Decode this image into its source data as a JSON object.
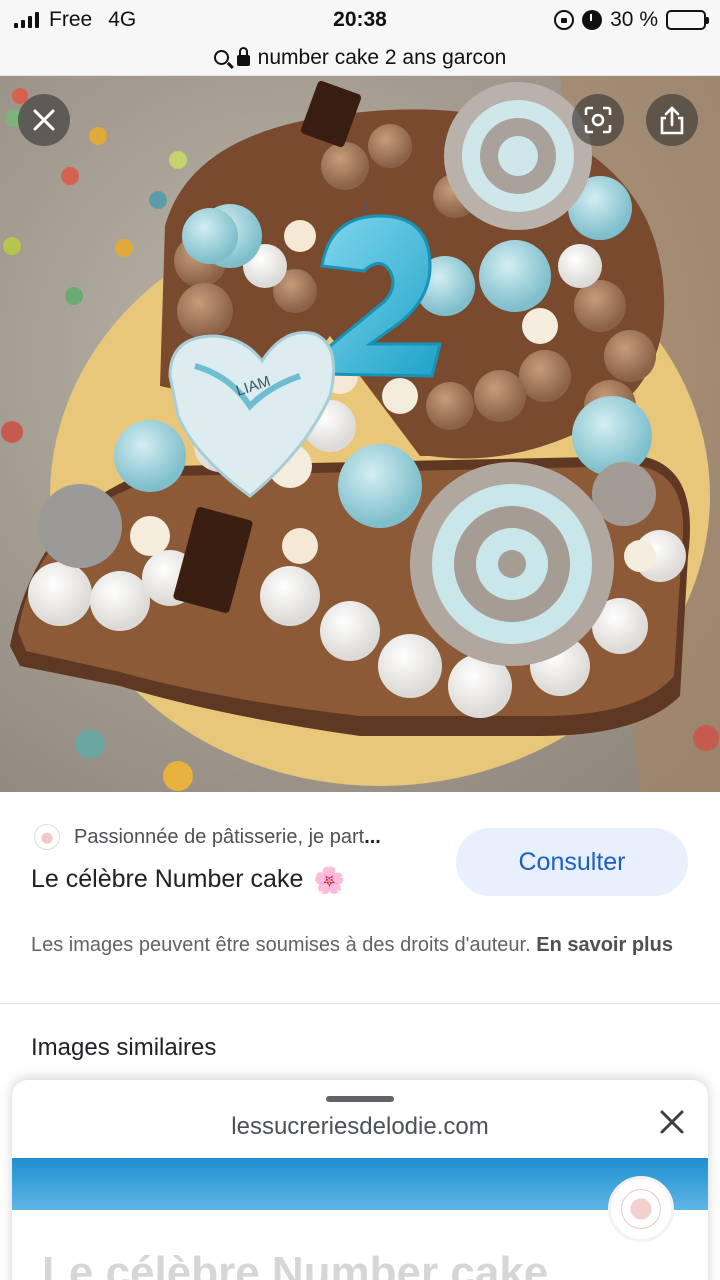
{
  "status_bar": {
    "carrier": "Free",
    "network": "4G",
    "time": "20:38",
    "battery": "30 %",
    "battery_level": 0.3,
    "icons": [
      "signal-icon",
      "rotation-lock-icon",
      "alarm-icon",
      "battery-icon"
    ]
  },
  "address_bar": {
    "query": "number cake 2 ans garcon",
    "icons": [
      "search-icon",
      "padlock-icon"
    ]
  },
  "viewer": {
    "overlay_icons": [
      "close-icon",
      "lens-icon",
      "share-icon"
    ],
    "candle_number": "2",
    "heart_name": "LIAM",
    "colors": {
      "meringue_blue": "#8fd0dc",
      "sponge": "#7a4a2e",
      "board": "#e8c77a"
    }
  },
  "source": {
    "site_text": "Passionnée de pâtisserie, je part",
    "ellipsis": "...",
    "title": "Le célèbre Number cake",
    "title_emoji": "🌸",
    "consult_label": "Consulter",
    "rights_text": "Les images peuvent être soumises à des droits d'auteur.",
    "rights_link": "En savoir plus"
  },
  "similar_heading": "Images similaires",
  "sheet": {
    "domain": "lessucreriesdelodie.com",
    "faded_title": "Le célèbre Number cake"
  },
  "accent_color": "#1a5ec9"
}
